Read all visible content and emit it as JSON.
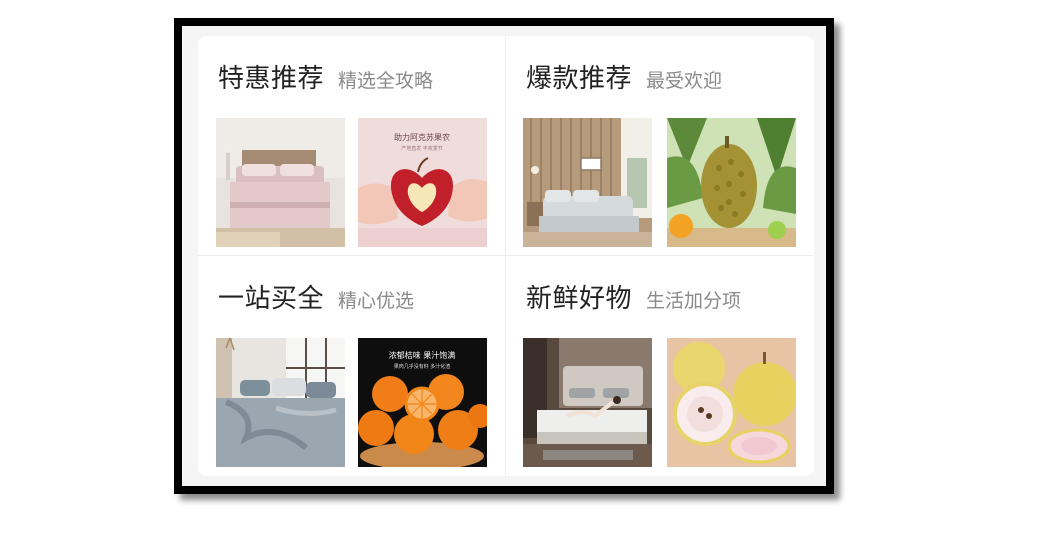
{
  "sections": [
    {
      "title": "特惠推荐",
      "subtitle": "精选全攻略",
      "products": [
        {
          "icon": "bedding-set-image"
        },
        {
          "icon": "apple-heart-image",
          "caption_line1": "助力阿克苏果农",
          "caption_line2": "产地直发 丰收季节"
        }
      ]
    },
    {
      "title": "爆款推荐",
      "subtitle": "最受欢迎",
      "products": [
        {
          "icon": "bedroom-wood-wall-image"
        },
        {
          "icon": "durian-image"
        }
      ]
    },
    {
      "title": "一站买全",
      "subtitle": "精心优选",
      "products": [
        {
          "icon": "gray-bedding-image"
        },
        {
          "icon": "orange-fruit-image",
          "caption_line1": "浓郁桔味 果汁饱满",
          "caption_line2": "果肉几乎没有籽 多汁化渣"
        }
      ]
    },
    {
      "title": "新鲜好物",
      "subtitle": "生活加分项",
      "products": [
        {
          "icon": "mattress-image"
        },
        {
          "icon": "snow-pear-image"
        }
      ]
    }
  ]
}
